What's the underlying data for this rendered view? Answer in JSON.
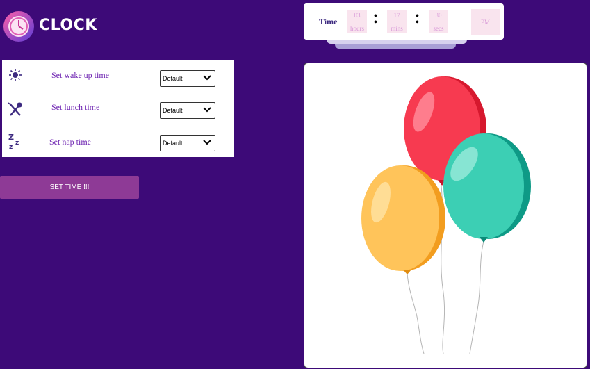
{
  "app": {
    "title": "CLOCK"
  },
  "time": {
    "label": "Time",
    "hours": "03",
    "hours_unit": "hours",
    "mins": "17",
    "mins_unit": "mins",
    "secs": "30",
    "secs_unit": "secs",
    "ampm": "PM"
  },
  "settings": {
    "rows": [
      {
        "icon": "sun-icon",
        "label": "Set wake up time",
        "value": "Default"
      },
      {
        "icon": "fork-spoon-icon",
        "label": "Set lunch time",
        "value": "Default"
      },
      {
        "icon": "sleep-zzz-icon",
        "label": "Set nap time",
        "value": "Default"
      }
    ]
  },
  "actions": {
    "set_time_label": "SET TIME !!!"
  },
  "colors": {
    "background": "#3d0a78",
    "accent": "#8e3a96",
    "text_purple": "#6b1fb0"
  },
  "image": {
    "name": "balloons-illustration"
  }
}
